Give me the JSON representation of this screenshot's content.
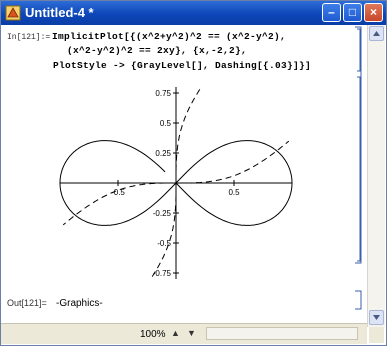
{
  "window": {
    "title": "Untitled-4 *"
  },
  "cell": {
    "in_label": "In[121]:=",
    "code_lines": [
      "ImplicitPlot[{(x^2+y^2)^2 == (x^2-y^2),",
      "(x^2-y^2)^2 == 2xy}, {x,-2,2},",
      "PlotStyle -> {GrayLevel[], Dashing[{.03}]}]"
    ],
    "out_label": "Out[121]=",
    "out_value": "-Graphics-"
  },
  "chart_data": {
    "type": "line",
    "series": [
      {
        "style": "solid",
        "equation": "(x^2+y^2)^2 == (x^2-y^2)"
      },
      {
        "style": "dashed",
        "equation": "(x^2-y^2)^2 == 2xy"
      }
    ],
    "xlim": [
      -1,
      1
    ],
    "ylim": [
      -0.75,
      0.75
    ],
    "x_ticks": [
      {
        "value": -0.5,
        "label": "-0.5"
      },
      {
        "value": 0.5,
        "label": "0.5"
      }
    ],
    "y_ticks": [
      {
        "value": 0.75,
        "label": "0.75"
      },
      {
        "value": 0.5,
        "label": "0.5"
      },
      {
        "value": 0.25,
        "label": "0.25"
      },
      {
        "value": -0.25,
        "label": "-0.25"
      },
      {
        "value": -0.5,
        "label": "-0.5"
      },
      {
        "value": -0.75,
        "label": "-0.75"
      }
    ]
  },
  "status": {
    "zoom": "100%"
  },
  "icons": {
    "minimize": "minimize-icon",
    "maximize": "maximize-icon",
    "close": "close-icon",
    "window": "notebook-icon"
  }
}
